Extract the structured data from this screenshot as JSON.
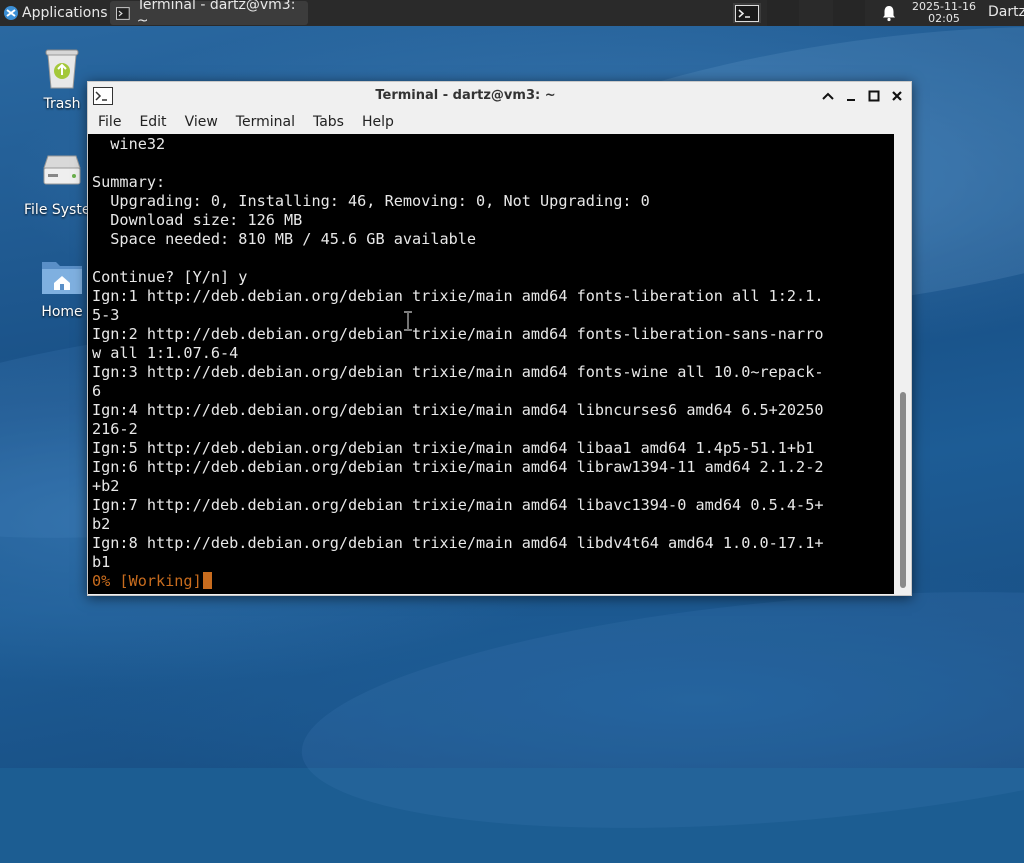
{
  "panel": {
    "applications_label": "Applications",
    "task_label": "Terminal - dartz@vm3: ~",
    "clock_date": "2025-11-16",
    "clock_time": "02:05",
    "user": "Dartz"
  },
  "desktop": {
    "icons": [
      {
        "label": "Trash",
        "icon": "trash-icon"
      },
      {
        "label": "File Syste",
        "icon": "drive-icon"
      },
      {
        "label": "Home",
        "icon": "home-folder-icon"
      }
    ]
  },
  "window": {
    "title": "Terminal - dartz@vm3: ~",
    "menu": [
      "File",
      "Edit",
      "View",
      "Terminal",
      "Tabs",
      "Help"
    ]
  },
  "terminal": {
    "lines": [
      "  wine32",
      "",
      "Summary:",
      "  Upgrading: 0, Installing: 46, Removing: 0, Not Upgrading: 0",
      "  Download size: 126 MB",
      "  Space needed: 810 MB / 45.6 GB available",
      "",
      "Continue? [Y/n] y",
      "Ign:1 http://deb.debian.org/debian trixie/main amd64 fonts-liberation all 1:2.1.",
      "5-3",
      "Ign:2 http://deb.debian.org/debian trixie/main amd64 fonts-liberation-sans-narro",
      "w all 1:1.07.6-4",
      "Ign:3 http://deb.debian.org/debian trixie/main amd64 fonts-wine all 10.0~repack-",
      "6",
      "Ign:4 http://deb.debian.org/debian trixie/main amd64 libncurses6 amd64 6.5+20250",
      "216-2",
      "Ign:5 http://deb.debian.org/debian trixie/main amd64 libaa1 amd64 1.4p5-51.1+b1",
      "Ign:6 http://deb.debian.org/debian trixie/main amd64 libraw1394-11 amd64 2.1.2-2",
      "+b2",
      "Ign:7 http://deb.debian.org/debian trixie/main amd64 libavc1394-0 amd64 0.5.4-5+",
      "b2",
      "Ign:8 http://deb.debian.org/debian trixie/main amd64 libdv4t64 amd64 1.0.0-17.1+",
      "b1"
    ],
    "progress_line": "0% [Working]"
  },
  "colors": {
    "panel_bg": "#2a2a2a",
    "terminal_bg": "#000000",
    "terminal_fg": "#e8e8e8",
    "progress_fg": "#c86c1e"
  }
}
